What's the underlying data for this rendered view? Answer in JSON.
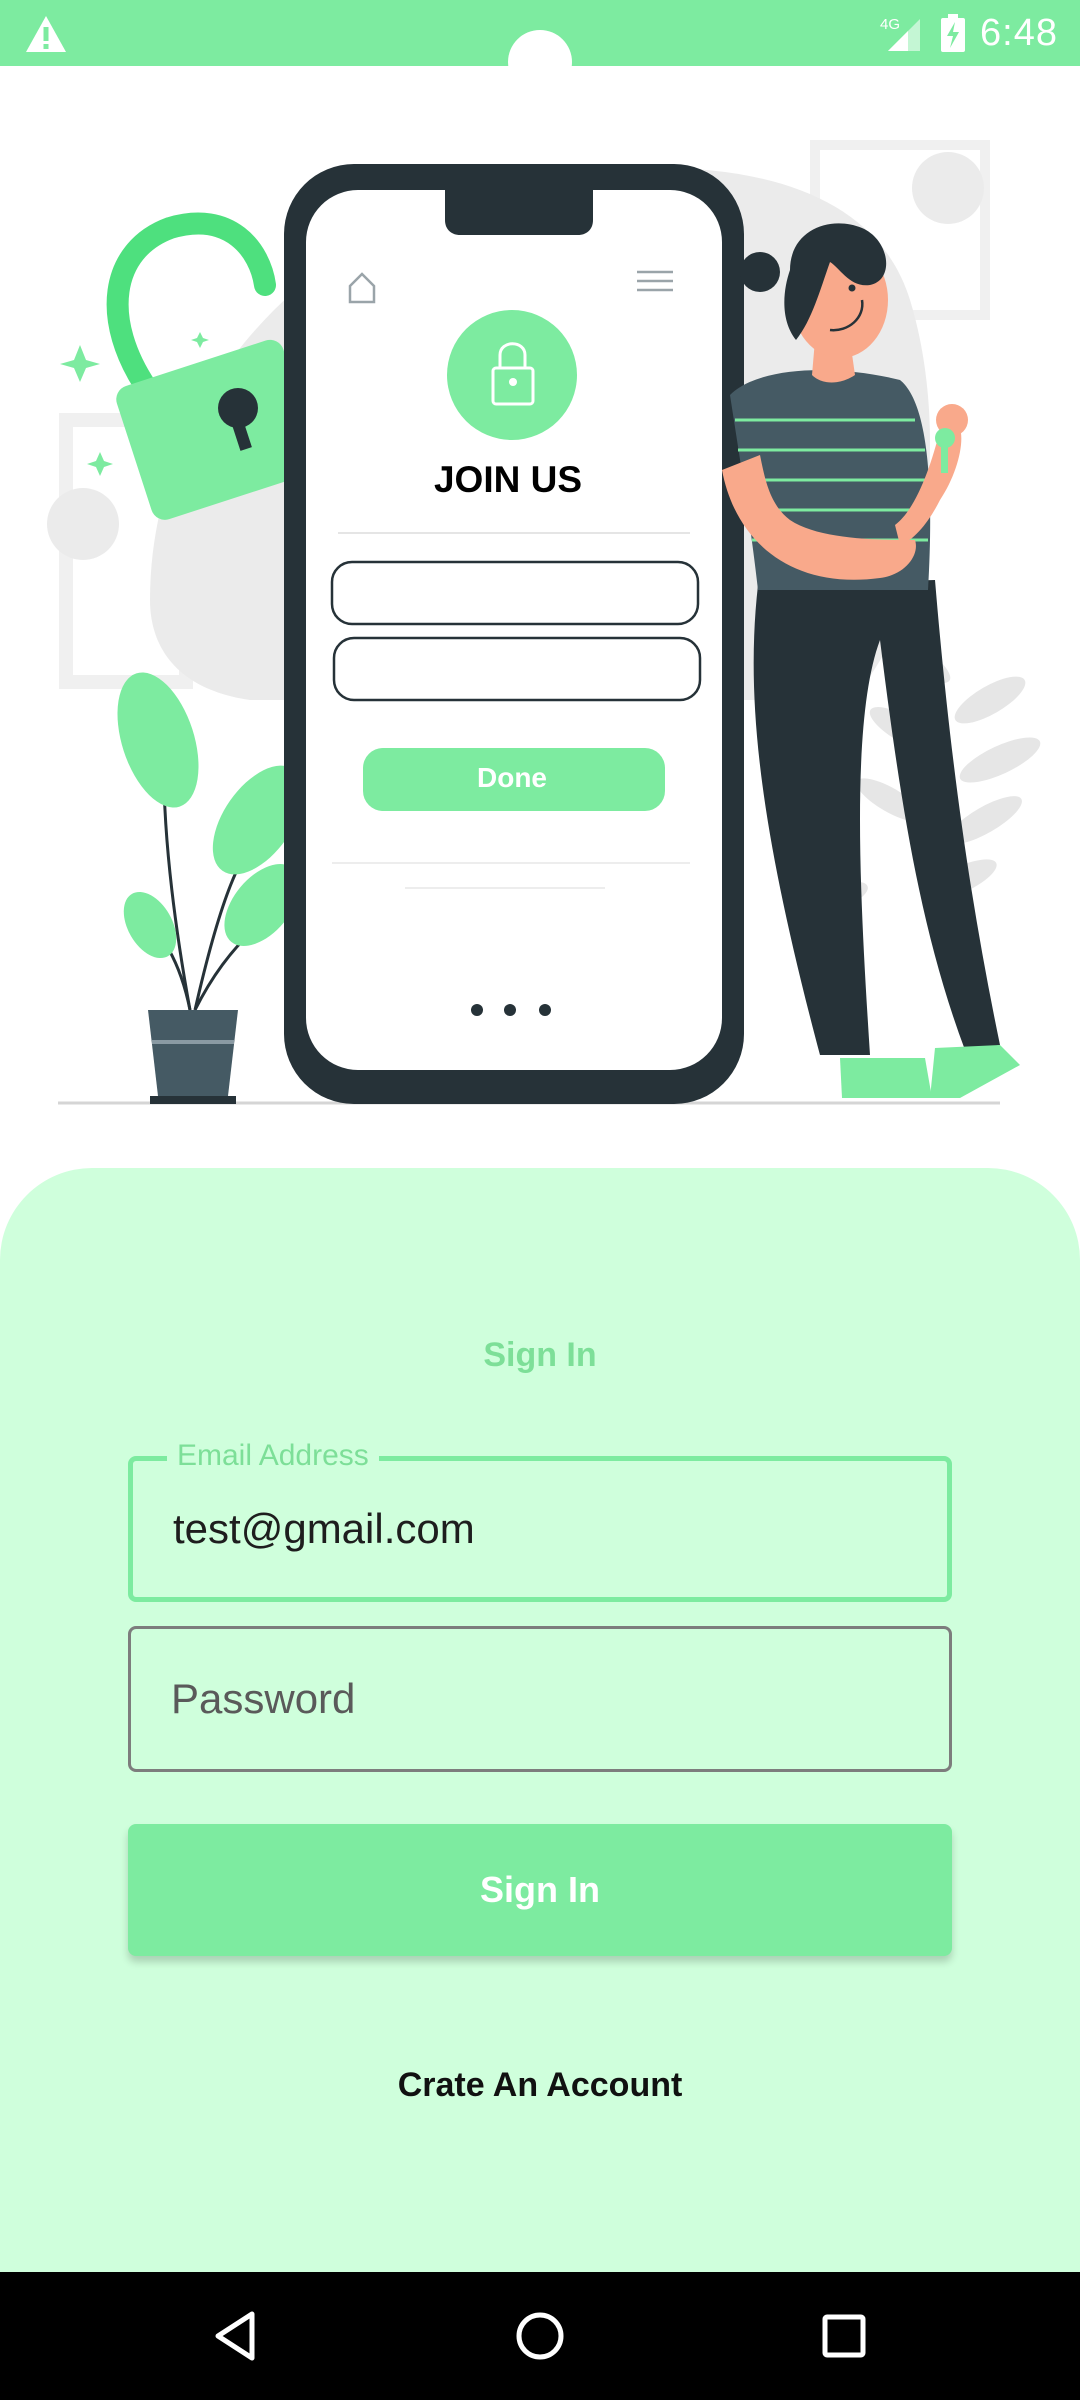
{
  "status_bar": {
    "network": "4G",
    "time": "6:48"
  },
  "hero": {
    "phone_title": "JOIN US",
    "phone_button": "Done"
  },
  "form": {
    "title": "Sign In",
    "email": {
      "label": "Email Address",
      "value": "test@gmail.com"
    },
    "password": {
      "placeholder": "Password"
    },
    "submit_label": "Sign In",
    "create_account_label": "Crate An Account"
  },
  "colors": {
    "accent": "#7deba0",
    "sheet_background": "#cfffdc",
    "dark": "#263238"
  },
  "nav_bar": {
    "icons": [
      "back-icon",
      "home-icon",
      "recents-icon"
    ]
  }
}
